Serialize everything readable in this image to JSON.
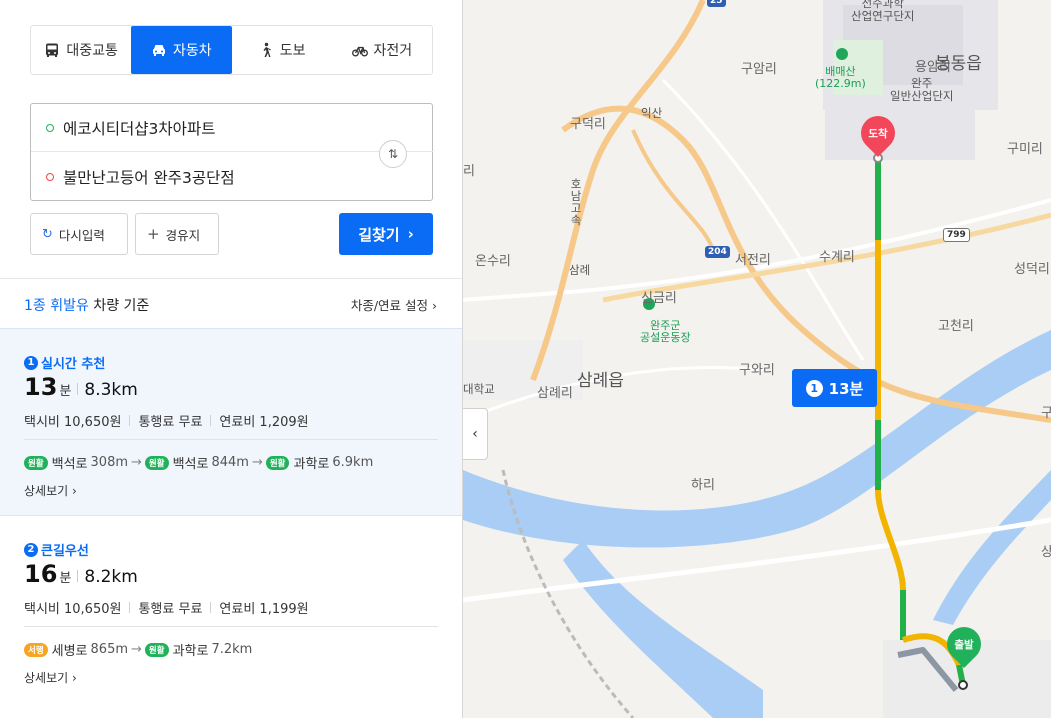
{
  "modes": [
    {
      "label": "대중교통",
      "icon": "bus-icon",
      "active": false
    },
    {
      "label": "자동차",
      "icon": "car-icon",
      "active": true
    },
    {
      "label": "도보",
      "icon": "walk-icon",
      "active": false
    },
    {
      "label": "자전거",
      "icon": "bike-icon",
      "active": false
    }
  ],
  "search": {
    "start": "에코시티더샵3차아파트",
    "end": "불만난고등어 완주3공단점",
    "reset_label": "다시입력",
    "via_label": "경유지",
    "search_label": "길찾기",
    "swap_icon": "⇅"
  },
  "vehicle": {
    "highlight": "1종 휘발유",
    "text": " 차량 기준",
    "settings": "차종/연료 설정"
  },
  "routes": [
    {
      "number": "1",
      "title": "실시간 추천",
      "minutes": "13",
      "minute_unit": "분",
      "distance": "8.3km",
      "taxi": "택시비 10,650원",
      "toll": "통행료 무료",
      "fuel": "연료비 1,209원",
      "roads": [
        {
          "tag": "원활",
          "tag_color": "#1fb25a",
          "name": "백석로",
          "dist": "308m"
        },
        {
          "tag": "원활",
          "tag_color": "#1fb25a",
          "name": "백석로",
          "dist": "844m"
        },
        {
          "tag": "원활",
          "tag_color": "#1fb25a",
          "name": "과학로",
          "dist": "6.9km"
        }
      ],
      "detail": "상세보기"
    },
    {
      "number": "2",
      "title": "큰길우선",
      "minutes": "16",
      "minute_unit": "분",
      "distance": "8.2km",
      "taxi": "택시비 10,650원",
      "toll": "통행료 무료",
      "fuel": "연료비 1,199원",
      "roads": [
        {
          "tag": "서행",
          "tag_color": "#f6a623",
          "name": "세병로",
          "dist": "865m"
        },
        {
          "tag": "원활",
          "tag_color": "#1fb25a",
          "name": "과학로",
          "dist": "7.2km"
        }
      ],
      "detail": "상세보기"
    }
  ],
  "map": {
    "labels": {
      "science_top": "전주과학\n산업연구단지",
      "guamri": "구암리",
      "baemaesan": "배매산\n(122.9m)",
      "yongam": "용암리",
      "bongdong": "봉동읍",
      "wanju_industrial": "완주\n일반산업단지",
      "gudeokri": "구덕리",
      "iksan": "익산",
      "gumiri": "구미리",
      "ri_left": "리",
      "honam": "호남고속",
      "onsuri": "온수리",
      "samrye_ic": "삼례",
      "seojeonri": "서전리",
      "sugyeri": "수계리",
      "route799": "799",
      "seongdeok": "성덕리",
      "singeumri": "신금리",
      "wanju_stadium": "완주군\n공설운동장",
      "gocheonri": "고천리",
      "samrye_eup": "삼례읍",
      "samrye_ri": "삼례리",
      "guwari": "구와리",
      "univ": "대학교",
      "gu_right": "구",
      "harye": "하리",
      "sang_right": "상",
      "route204": "204",
      "route25": "25"
    },
    "bubble": {
      "number": "1",
      "text": "13분"
    },
    "pin_end": "도착",
    "pin_start": "출발",
    "collapse_icon": "‹"
  }
}
